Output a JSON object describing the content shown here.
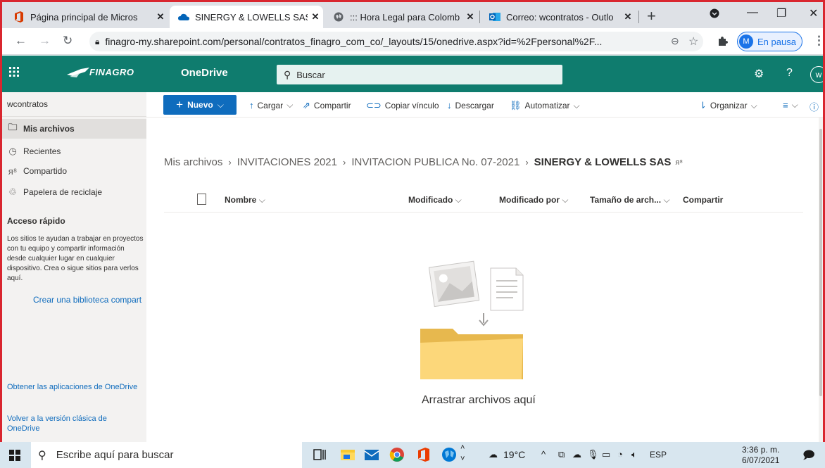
{
  "browser": {
    "tabs": [
      {
        "label": "Página principal de Micros",
        "icon": "office-icon",
        "active": false
      },
      {
        "label": "SINERGY & LOWELLS SAS",
        "icon": "onedrive-cloud-icon",
        "active": true
      },
      {
        "label": "::: Hora Legal para Colomb",
        "icon": "globe-icon",
        "active": false
      },
      {
        "label": "Correo: wcontratos - Outlo",
        "icon": "outlook-icon",
        "active": false
      }
    ],
    "url": "finagro-my.sharepoint.com/personal/contratos_finagro_com_co/_layouts/15/onedrive.aspx?id=%2Fpersonal%2F...",
    "profile_initial": "M",
    "profile_label": "En pausa"
  },
  "suitebar": {
    "brand": "FINAGRO",
    "app_name": "OneDrive",
    "search_placeholder": "Buscar",
    "user_initial": "w"
  },
  "leftnav": {
    "username": "wcontratos",
    "items": [
      {
        "label": "Mis archivos",
        "icon": "folder-icon",
        "selected": true
      },
      {
        "label": "Recientes",
        "icon": "clock-icon",
        "selected": false
      },
      {
        "label": "Compartido",
        "icon": "people-icon",
        "selected": false
      },
      {
        "label": "Papelera de reciclaje",
        "icon": "recycle-bin-icon",
        "selected": false
      }
    ],
    "quick_access_title": "Acceso rápido",
    "quick_access_text": "Los sitios te ayudan a trabajar en proyectos con tu equipo y compartir información desde cualquier lugar en cualquier dispositivo. Crea o sigue sitios para verlos aquí.",
    "create_library": "Crear una biblioteca compart",
    "get_apps": "Obtener las aplicaciones de OneDrive",
    "classic_view": "Volver a la versión clásica de OneDrive"
  },
  "commandbar": {
    "new_label": "Nuevo",
    "upload": "Cargar",
    "share": "Compartir",
    "copy_link": "Copiar vínculo",
    "download": "Descargar",
    "automate": "Automatizar",
    "organize": "Organizar"
  },
  "breadcrumb": [
    "Mis archivos",
    "INVITACIONES 2021",
    "INVITACION PUBLICA No. 07-2021"
  ],
  "current_folder": "SINERGY & LOWELLS SAS",
  "columns": {
    "name": "Nombre",
    "modified": "Modificado",
    "modified_by": "Modificado por",
    "size": "Tamaño de arch...",
    "sharing": "Compartir"
  },
  "empty_message": "Arrastrar archivos aquí",
  "taskbar": {
    "search_placeholder": "Escribe aquí para buscar",
    "temperature": "19°C",
    "language": "ESP",
    "time": "3:36 p. m.",
    "date": "6/07/2021"
  }
}
